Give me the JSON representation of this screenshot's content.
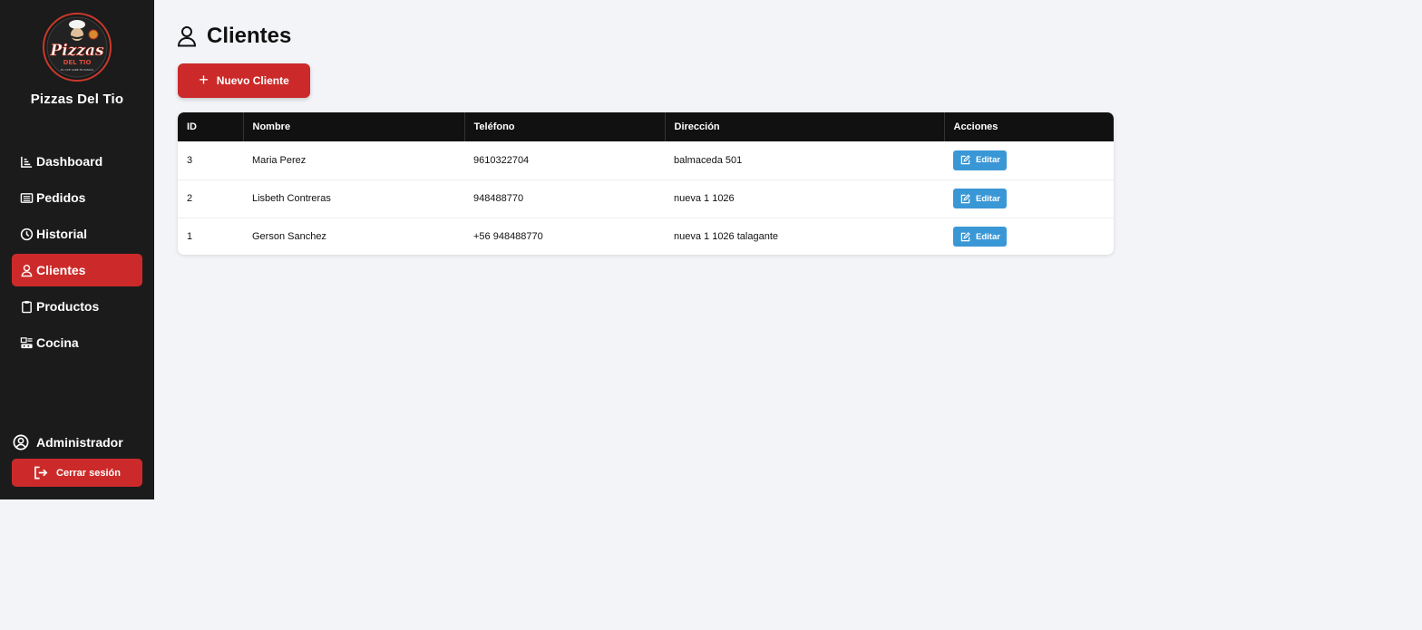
{
  "sidebar": {
    "brand": "Pizzas Del Tio",
    "logo": {
      "line1": "Pizzas",
      "line2": "DEL TIO",
      "tagline": "EL QUE SABE ES PIZZAS"
    },
    "items": [
      {
        "label": "Dashboard",
        "icon": "chart-icon"
      },
      {
        "label": "Pedidos",
        "icon": "list-icon"
      },
      {
        "label": "Historial",
        "icon": "clock-icon"
      },
      {
        "label": "Clientes",
        "icon": "user-icon",
        "active": true
      },
      {
        "label": "Productos",
        "icon": "clipboard-icon"
      },
      {
        "label": "Cocina",
        "icon": "kitchen-icon"
      }
    ],
    "user": "Administrador",
    "logout_label": "Cerrar sesión"
  },
  "main": {
    "title": "Clientes",
    "new_button_label": "Nuevo Cliente",
    "table": {
      "headers": [
        "ID",
        "Nombre",
        "Teléfono",
        "Dirección",
        "Acciones"
      ],
      "rows": [
        {
          "id": "3",
          "nombre": "Maria Perez",
          "telefono": "9610322704",
          "direccion": "balmaceda 501",
          "accion": "Editar"
        },
        {
          "id": "2",
          "nombre": "Lisbeth Contreras",
          "telefono": "948488770",
          "direccion": "nueva 1 1026",
          "accion": "Editar"
        },
        {
          "id": "1",
          "nombre": "Gerson Sanchez",
          "telefono": "+56 948488770",
          "direccion": "nueva 1 1026 talagante",
          "accion": "Editar"
        }
      ]
    }
  },
  "colors": {
    "sidebar_bg": "#1b1b1b",
    "accent_red": "#cc2a2a",
    "edit_blue": "#3a97d6",
    "page_bg": "#f3f4f8"
  }
}
